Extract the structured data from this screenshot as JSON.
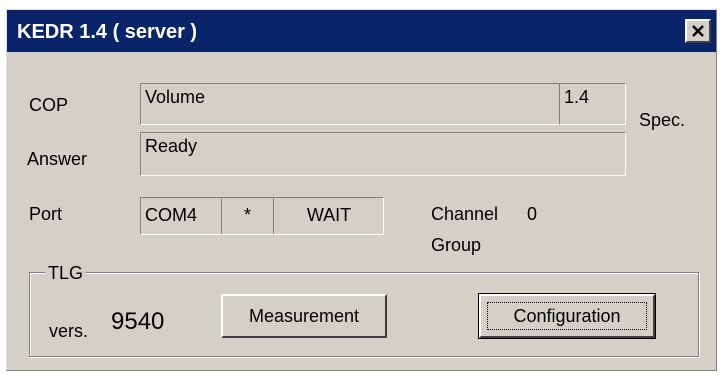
{
  "window": {
    "title": "KEDR 1.4 ( server )",
    "close_icon": "close-icon"
  },
  "cop": {
    "label": "COP",
    "value": "Volume",
    "version": "1.4",
    "spec_label": "Spec."
  },
  "answer": {
    "label": "Answer",
    "value": "Ready"
  },
  "port": {
    "label": "Port",
    "name": "COM4",
    "flag": "*",
    "state": "WAIT",
    "channel_label": "Channel",
    "channel_value": "0",
    "group_label": "Group"
  },
  "tlg": {
    "title": "TLG",
    "vers_label": "vers.",
    "vers_value": "9540",
    "measurement_button": "Measurement",
    "configuration_button": "Configuration"
  },
  "colors": {
    "titlebar": "#0a246a",
    "face": "#d4d0c8"
  }
}
